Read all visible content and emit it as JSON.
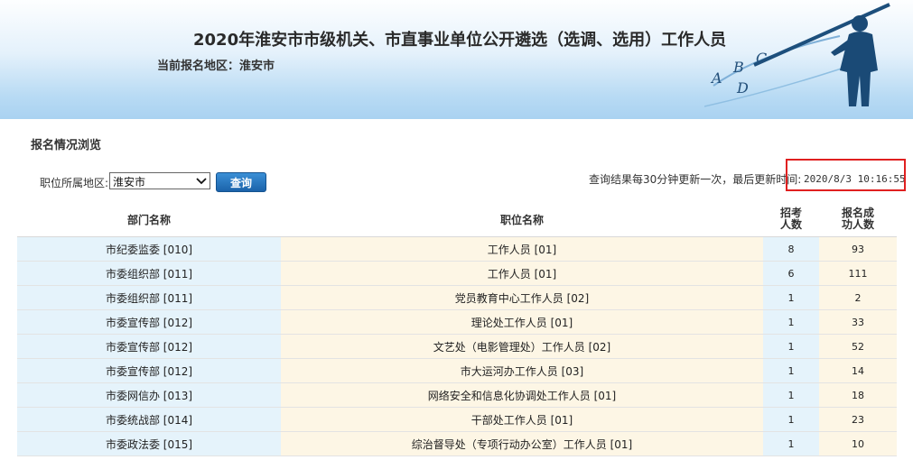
{
  "header": {
    "title": "2020年淮安市市级机关、市直事业单位公开遴选（选调、选用）工作人员",
    "current_region": "当前报名地区：淮安市",
    "deco_letters": [
      "A",
      "B",
      "C",
      "D"
    ]
  },
  "section": {
    "title": "报名情况浏览"
  },
  "filter": {
    "label": "职位所属地区:",
    "selected": "淮安市",
    "query_button": "查询"
  },
  "update": {
    "note": "查询结果每30分钟更新一次，最后更新时间:",
    "time": "2020/8/3 10:16:55"
  },
  "table": {
    "headers": [
      "部门名称",
      "职位名称",
      "招考人数",
      "报名成功人数"
    ],
    "rows": [
      [
        "市纪委监委 [010]",
        "工作人员 [01]",
        "8",
        "93"
      ],
      [
        "市委组织部 [011]",
        "工作人员 [01]",
        "6",
        "111"
      ],
      [
        "市委组织部 [011]",
        "党员教育中心工作人员 [02]",
        "1",
        "2"
      ],
      [
        "市委宣传部 [012]",
        "理论处工作人员 [01]",
        "1",
        "33"
      ],
      [
        "市委宣传部 [012]",
        "文艺处（电影管理处）工作人员 [02]",
        "1",
        "52"
      ],
      [
        "市委宣传部 [012]",
        "市大运河办工作人员 [03]",
        "1",
        "14"
      ],
      [
        "市委网信办 [013]",
        "网络安全和信息化协调处工作人员 [01]",
        "1",
        "18"
      ],
      [
        "市委统战部 [014]",
        "干部处工作人员 [01]",
        "1",
        "23"
      ],
      [
        "市委政法委 [015]",
        "综治督导处（专项行动办公室）工作人员 [01]",
        "1",
        "10"
      ]
    ]
  },
  "colors": {
    "header_gradient_bottom": "#a9d2f1",
    "dept_col_bg": "#e5f3fb",
    "pos_col_bg": "#fdf6e5",
    "button_bg": "#1b63aa",
    "highlight_box": "#e02020"
  }
}
